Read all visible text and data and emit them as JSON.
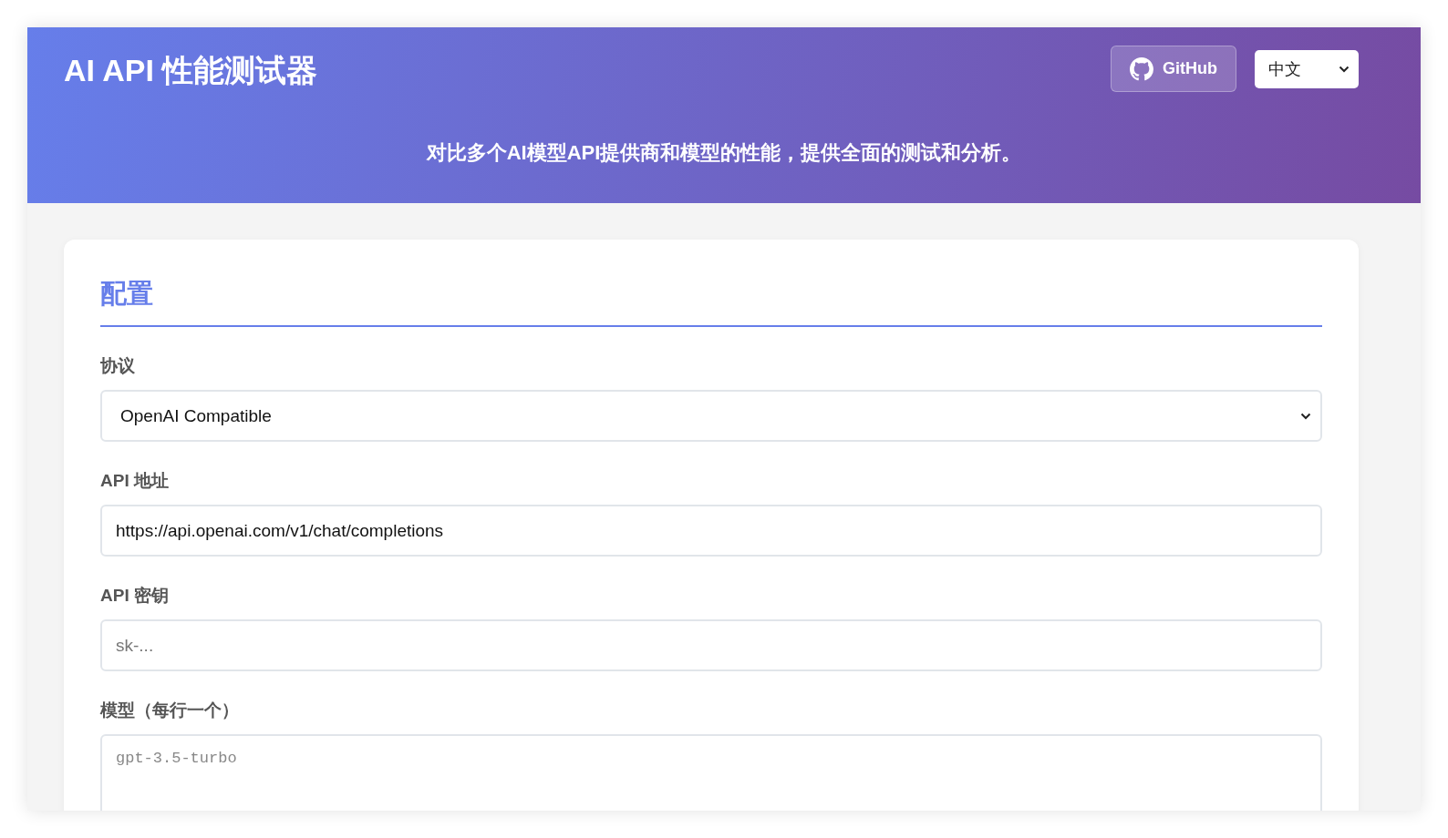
{
  "header": {
    "title": "AI API 性能测试器",
    "github_button": "GitHub",
    "language_select": {
      "value": "中文"
    },
    "subtitle": "对比多个AI模型API提供商和模型的性能，提供全面的测试和分析。"
  },
  "config": {
    "heading": "配置",
    "fields": [
      {
        "kind": "select",
        "label": "协议",
        "value": "OpenAI Compatible"
      },
      {
        "kind": "input",
        "label": "API 地址",
        "value": "https://api.openai.com/v1/chat/completions"
      },
      {
        "kind": "input",
        "label": "API 密钥",
        "placeholder": "sk-..."
      },
      {
        "kind": "textarea",
        "label": "模型（每行一个）",
        "placeholder": "gpt-3.5-turbo"
      }
    ]
  }
}
